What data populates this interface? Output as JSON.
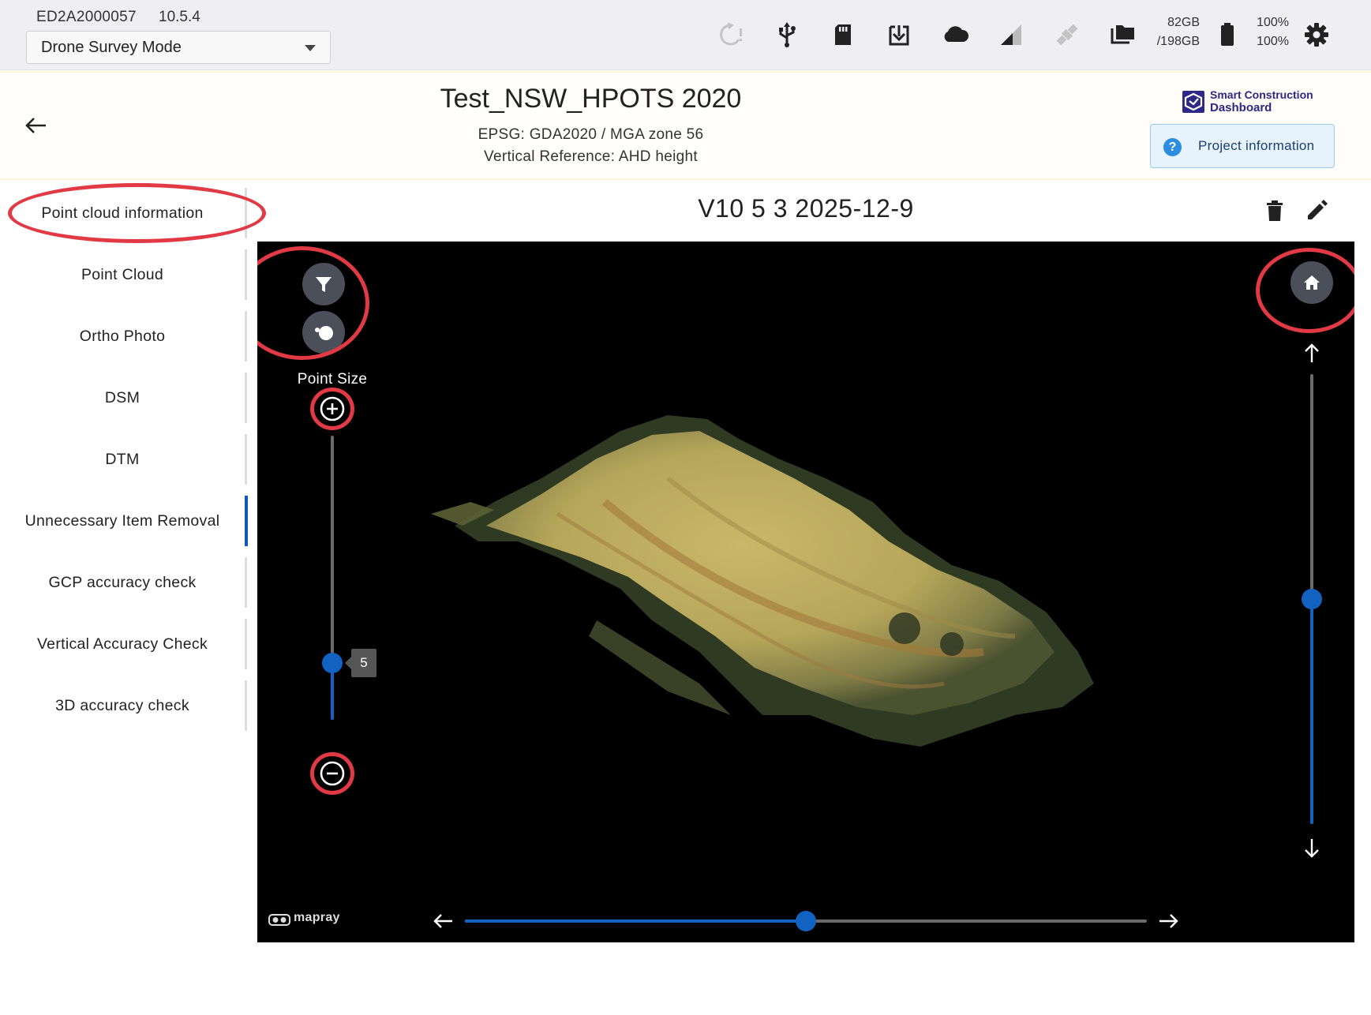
{
  "status_bar": {
    "device_id": "ED2A2000057",
    "version": "10.5.4",
    "mode_select": {
      "value": "Drone Survey Mode"
    },
    "icons": [
      "sync-warning-icon",
      "usb-icon",
      "sd-card-icon",
      "download-icon",
      "cloud-icon",
      "signal-icon",
      "satellite-icon",
      "folder-icon",
      "battery-icon",
      "gear-icon"
    ],
    "storage_used": "82GB",
    "storage_total": "/198GB",
    "battery_1": "100%",
    "battery_2": "100%"
  },
  "header": {
    "project_title": "Test_NSW_HPOTS 2020",
    "epsg": "EPSG: GDA2020 / MGA zone 56",
    "vertical_reference": "Vertical Reference: AHD height",
    "logo_line1": "Smart Construction",
    "logo_line2": "Dashboard",
    "project_info_label": "Project information"
  },
  "sidebar": {
    "items": [
      {
        "label": "Point cloud information",
        "active": false
      },
      {
        "label": "Point Cloud",
        "active": false
      },
      {
        "label": "Ortho Photo",
        "active": false
      },
      {
        "label": "DSM",
        "active": false
      },
      {
        "label": "DTM",
        "active": false
      },
      {
        "label": "Unnecessary Item Removal",
        "active": true
      },
      {
        "label": "GCP accuracy check",
        "active": false
      },
      {
        "label": "Vertical Accuracy Check",
        "active": false
      },
      {
        "label": "3D accuracy check",
        "active": false
      }
    ]
  },
  "content": {
    "title": "V10 5 3 2025-12-9"
  },
  "viewer": {
    "point_size_label": "Point Size",
    "point_size_value": "5",
    "point_size_fraction": 0.2,
    "vertical_slider_fraction": 0.5,
    "horizontal_slider_fraction": 0.5,
    "watermark": "mapray"
  },
  "colors": {
    "accent": "#1262c2",
    "annotation_ring": "#e23a45",
    "viewer_bg": "#000000"
  }
}
